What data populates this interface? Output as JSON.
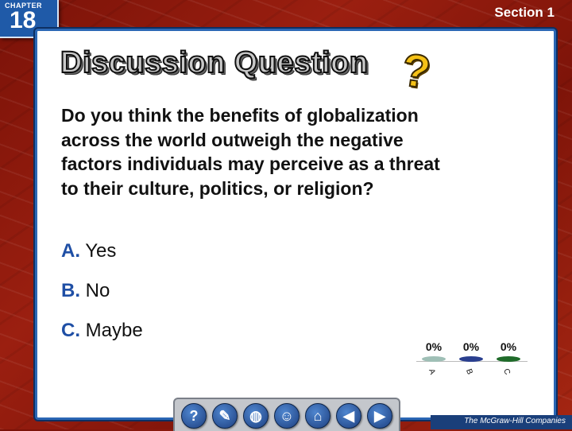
{
  "header": {
    "chapter_label": "CHAPTER",
    "chapter_number": "18",
    "section_label": "Section 1"
  },
  "slide": {
    "title": "Discussion Question",
    "title_mark": "?",
    "question": "Do you think the benefits of globalization across the world outweigh the negative factors individuals may perceive as a threat to their culture, politics, or religion?",
    "answers": [
      {
        "letter": "A.",
        "text": "Yes"
      },
      {
        "letter": "B.",
        "text": "No"
      },
      {
        "letter": "C.",
        "text": "Maybe"
      }
    ]
  },
  "chart_data": {
    "type": "bar",
    "categories": [
      "A",
      "B",
      "C"
    ],
    "values": [
      0,
      0,
      0
    ],
    "value_labels": [
      "0%",
      "0%",
      "0%"
    ],
    "colors": [
      "#9fbfb6",
      "#2a3f8f",
      "#1f6b2a"
    ]
  },
  "navbar": {
    "buttons": [
      {
        "name": "help-icon",
        "glyph": "?"
      },
      {
        "name": "tools-icon",
        "glyph": "✎"
      },
      {
        "name": "globe-icon",
        "glyph": "◍"
      },
      {
        "name": "presenter-icon",
        "glyph": "☺"
      },
      {
        "name": "home-icon",
        "glyph": "⌂"
      },
      {
        "name": "back-icon",
        "glyph": "◀"
      },
      {
        "name": "forward-icon",
        "glyph": "▶"
      }
    ]
  },
  "footer": {
    "publisher": "The McGraw-Hill Companies"
  }
}
